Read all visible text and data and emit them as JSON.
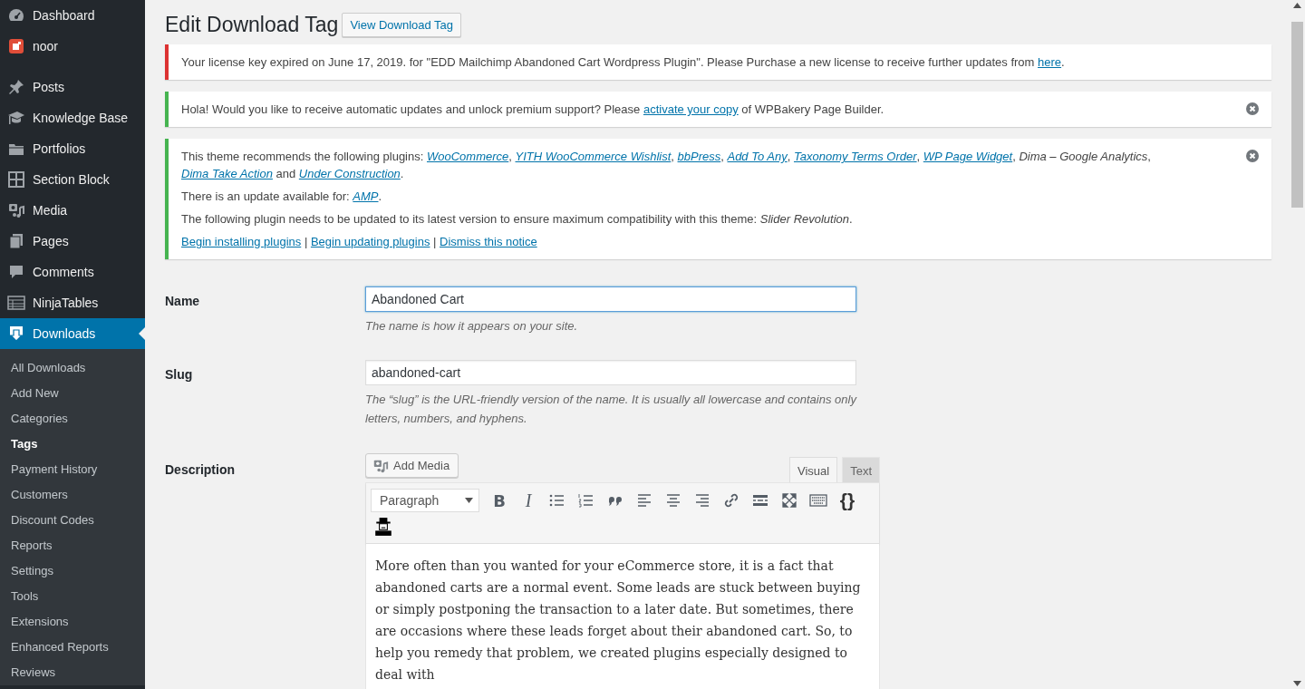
{
  "sidebar": {
    "menu": [
      {
        "kind": "item",
        "label": "Dashboard",
        "selected": false
      },
      {
        "kind": "item",
        "label": "noor",
        "selected": false
      },
      {
        "kind": "separator"
      },
      {
        "kind": "item",
        "label": "Posts",
        "selected": false
      },
      {
        "kind": "item",
        "label": "Knowledge Base",
        "selected": false
      },
      {
        "kind": "item",
        "label": "Portfolios",
        "selected": false
      },
      {
        "kind": "item",
        "label": "Section Block",
        "selected": false
      },
      {
        "kind": "item",
        "label": "Media",
        "selected": false
      },
      {
        "kind": "item",
        "label": "Pages",
        "selected": false
      },
      {
        "kind": "item",
        "label": "Comments",
        "selected": false
      },
      {
        "kind": "item",
        "label": "NinjaTables",
        "selected": false
      },
      {
        "kind": "item",
        "label": "Downloads",
        "selected": true
      }
    ],
    "submenu": [
      {
        "label": "All Downloads",
        "selected": false
      },
      {
        "label": "Add New",
        "selected": false
      },
      {
        "label": "Categories",
        "selected": false
      },
      {
        "label": "Tags",
        "selected": true
      },
      {
        "label": "Payment History",
        "selected": false
      },
      {
        "label": "Customers",
        "selected": false
      },
      {
        "label": "Discount Codes",
        "selected": false
      },
      {
        "label": "Reports",
        "selected": false
      },
      {
        "label": "Settings",
        "selected": false
      },
      {
        "label": "Tools",
        "selected": false
      },
      {
        "label": "Extensions",
        "selected": false
      },
      {
        "label": "Enhanced Reports",
        "selected": false
      },
      {
        "label": "Reviews",
        "selected": false
      }
    ]
  },
  "page": {
    "title": "Edit Download Tag",
    "view_button": "View Download Tag"
  },
  "notices": [
    {
      "kind": "error",
      "dismissible": false,
      "paragraphs": [
        [
          {
            "text": "Your license key expired on June 17, 2019. for \"EDD Mailchimp Abandoned Cart Wordpress Plugin\". Please Purchase a new license to receive further updates from "
          },
          {
            "text": "here",
            "link": true
          },
          {
            "text": "."
          }
        ]
      ]
    },
    {
      "kind": "success",
      "dismissible": true,
      "paragraphs": [
        [
          {
            "text": "Hola! Would you like to receive automatic updates and unlock premium support? Please "
          },
          {
            "text": "activate your copy",
            "link": true
          },
          {
            "text": " of WPBakery Page Builder."
          }
        ]
      ]
    },
    {
      "kind": "success",
      "dismissible": true,
      "paragraphs": [
        [
          {
            "text": "This theme recommends the following plugins: "
          },
          {
            "text": "WooCommerce",
            "link": true,
            "italic": true
          },
          {
            "text": ", "
          },
          {
            "text": "YITH WooCommerce Wishlist",
            "link": true,
            "italic": true
          },
          {
            "text": ", "
          },
          {
            "text": "bbPress",
            "link": true,
            "italic": true
          },
          {
            "text": ", "
          },
          {
            "text": "Add To Any",
            "link": true,
            "italic": true
          },
          {
            "text": ", "
          },
          {
            "text": "Taxonomy Terms Order",
            "link": true,
            "italic": true
          },
          {
            "text": ", "
          },
          {
            "text": "WP Page Widget",
            "link": true,
            "italic": true
          },
          {
            "text": ", "
          },
          {
            "text": "Dima – Google Analytics",
            "italic": true
          },
          {
            "text": ", "
          },
          {
            "text": "Dima Take Action",
            "link": true,
            "italic": true
          },
          {
            "text": " and "
          },
          {
            "text": "Under Construction",
            "link": true,
            "italic": true
          },
          {
            "text": "."
          }
        ],
        [
          {
            "text": "There is an update available for: "
          },
          {
            "text": "AMP",
            "link": true,
            "italic": true
          },
          {
            "text": "."
          }
        ],
        [
          {
            "text": "The following plugin needs to be updated to its latest version to ensure maximum compatibility with this theme: "
          },
          {
            "text": "Slider Revolution",
            "italic": true
          },
          {
            "text": "."
          }
        ],
        [
          {
            "text": "Begin installing plugins",
            "link": true
          },
          {
            "text": " | "
          },
          {
            "text": "Begin updating plugins",
            "link": true
          },
          {
            "text": " | "
          },
          {
            "text": "Dismiss this notice",
            "link": true
          }
        ]
      ]
    }
  ],
  "form": {
    "name": {
      "label": "Name",
      "value": "Abandoned Cart",
      "focused": true,
      "hint": "The name is how it appears on your site."
    },
    "slug": {
      "label": "Slug",
      "value": "abandoned-cart",
      "focused": false,
      "hint": "The “slug” is the URL-friendly version of the name. It is usually all lowercase and contains only letters, numbers, and hyphens."
    },
    "description": {
      "label": "Description",
      "add_media": "Add Media",
      "tabs": [
        {
          "label": "Visual",
          "selected": true
        },
        {
          "label": "Text",
          "selected": false
        }
      ],
      "format": "Paragraph",
      "toolbar": [
        {
          "kind": "bold",
          "label": "B"
        },
        {
          "kind": "italic",
          "label": "I"
        },
        {
          "kind": "bullets"
        },
        {
          "kind": "numbers"
        },
        {
          "kind": "quote"
        },
        {
          "kind": "align-left"
        },
        {
          "kind": "align-center"
        },
        {
          "kind": "align-right"
        },
        {
          "kind": "link"
        },
        {
          "kind": "more"
        },
        {
          "kind": "fullscreen"
        },
        {
          "kind": "keyboard"
        },
        {
          "kind": "braces",
          "label": "{}"
        },
        {
          "kind": "spy"
        }
      ],
      "content": "More often than you wanted for your eCommerce store, it is a fact that abandoned carts are a normal event. Some leads are stuck between buying or simply postponing the transaction to a later date. But sometimes, there are occasions where these leads forget about their abandoned cart. So, to help you remedy that problem, we created plugins especially designed to deal with"
    }
  }
}
